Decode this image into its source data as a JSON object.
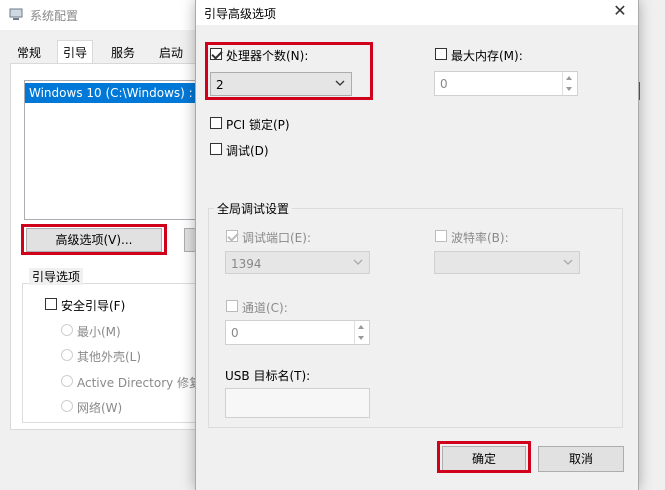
{
  "bg_window": {
    "title": "系统配置",
    "tabs": [
      "常规",
      "引导",
      "服务",
      "启动"
    ],
    "active_tab": "引导",
    "os_item": "Windows 10 (C:\\Windows) : 当",
    "advanced_button": "高级选项(V)...",
    "boot_options_title": "引导选项",
    "safe_boot": "安全引导(F)",
    "radio_options": [
      "最小(M)",
      "其他外壳(L)",
      "Active Directory 修复",
      "网络(W)"
    ]
  },
  "dialog": {
    "title": "引导高级选项",
    "close_glyph": "✕",
    "processors_label": "处理器个数(N):",
    "processors_checked": true,
    "processors_value": "2",
    "max_memory_label": "最大内存(M):",
    "max_memory_value": "0",
    "pci_lock_label": "PCI 锁定(P)",
    "debug_label": "调试(D)",
    "global_debug_title": "全局调试设置",
    "debug_port_label": "调试端口(E):",
    "debug_port_value": "1394",
    "baud_rate_label": "波特率(B):",
    "channel_label": "通道(C):",
    "channel_value": "0",
    "usb_target_label": "USB 目标名(T):",
    "ok_button": "确定",
    "cancel_button": "取消"
  },
  "colors": {
    "highlight_red": "#d0021b",
    "selection_blue": "#0078d7"
  }
}
